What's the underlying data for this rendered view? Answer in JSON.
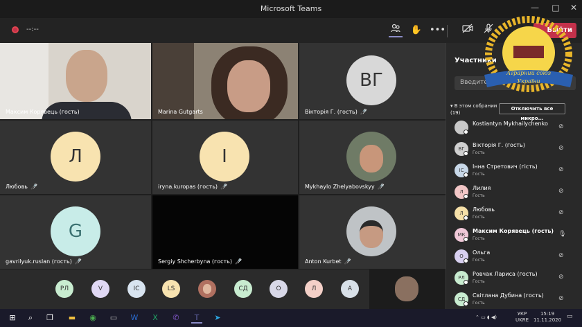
{
  "window": {
    "title": "Microsoft Teams",
    "minimize": "—",
    "maximize": "□",
    "close": "✕"
  },
  "toolbar": {
    "timer": "--:--",
    "more": "•••",
    "leave_label": "Выйти"
  },
  "tiles": [
    {
      "name": "Максим Корявець (гость)",
      "muted": false
    },
    {
      "name": "Marina Gutgarts",
      "muted": false
    },
    {
      "name": "Вікторія Г. (гость)",
      "initials": "ВГ",
      "muted": true
    },
    {
      "name": "Любовь",
      "initials": "Л",
      "muted": true
    },
    {
      "name": "iryna.kuropas (гость)",
      "initials": "I",
      "muted": true
    },
    {
      "name": "Mykhaylo Zhelyabovskyy",
      "muted": true
    },
    {
      "name": "gavrilyuk.ruslan (гость)",
      "initials": "G",
      "muted": true
    },
    {
      "name": "Sergiy Shcherbyna (гость)",
      "muted": true
    },
    {
      "name": "Anton Kurbet",
      "muted": true
    }
  ],
  "strip": [
    "РЛ",
    "V",
    "IC",
    "LS",
    "",
    "СД",
    "O",
    "Л",
    "A"
  ],
  "panel": {
    "title": "Участники",
    "search_placeholder": "Введите имя",
    "section_label": "В этом собрании (19)",
    "mute_all": "Отключить все микро...",
    "participants": [
      {
        "initials": "",
        "name": "Kostiantyn Mykhailychenko",
        "sub": "",
        "color": "#c8c8c8"
      },
      {
        "initials": "ВГ",
        "name": "Вікторія Г. (гость)",
        "sub": "Гость",
        "color": "#d0d0d0"
      },
      {
        "initials": "ІС",
        "name": "Інна Стретович (гість)",
        "sub": "Гость",
        "color": "#c8d8e8"
      },
      {
        "initials": "Л",
        "name": "Лилия",
        "sub": "Гость",
        "color": "#f2c6c6"
      },
      {
        "initials": "Л",
        "name": "Любовь",
        "sub": "Гость",
        "color": "#f6e0a8"
      },
      {
        "initials": "МК",
        "name": "Максим Корявець (гость)",
        "sub": "Гость",
        "color": "#f0c8d8"
      },
      {
        "initials": "О",
        "name": "Ольга",
        "sub": "Гость",
        "color": "#d8d0f0"
      },
      {
        "initials": "РЛ",
        "name": "Ровчак Лариса (гость)",
        "sub": "Гость",
        "color": "#c8ecd0"
      },
      {
        "initials": "СД",
        "name": "Світлана Дубина (гость)",
        "sub": "Гость",
        "color": "#c8ecd0"
      }
    ]
  },
  "logo": {
    "line1": "Аграрний союз",
    "line2": "України"
  },
  "taskbar": {
    "lang1": "УКР",
    "lang2": "UKRE",
    "time": "15:19",
    "date": "11.11.2020"
  }
}
